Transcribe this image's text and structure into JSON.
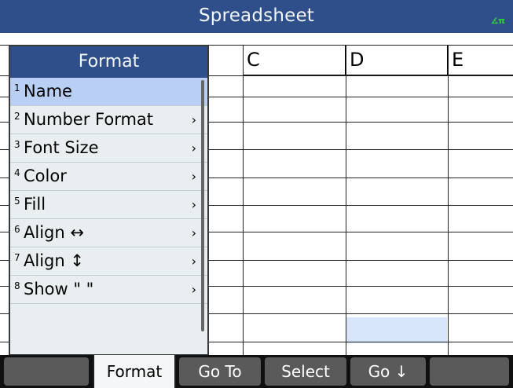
{
  "title_bar": {
    "title": "Spreadsheet",
    "angle_indicator": "∡π"
  },
  "spreadsheet": {
    "visible_columns": [
      "C",
      "D",
      "E"
    ],
    "selected_cell_column": "D"
  },
  "format_menu": {
    "header": "Format",
    "items": [
      {
        "num": "1",
        "label": "Name",
        "arrow": ""
      },
      {
        "num": "2",
        "label": "Number Format",
        "arrow": "›"
      },
      {
        "num": "3",
        "label": "Font Size",
        "arrow": "›"
      },
      {
        "num": "4",
        "label": "Color",
        "arrow": "›"
      },
      {
        "num": "5",
        "label": "Fill",
        "arrow": "›"
      },
      {
        "num": "6",
        "label": "Align ↔",
        "arrow": "›"
      },
      {
        "num": "7",
        "label": "Align ↕",
        "arrow": "›"
      },
      {
        "num": "8",
        "label": "Show \" \"",
        "arrow": "›"
      }
    ]
  },
  "softkeys": [
    "",
    "Format",
    "Go To",
    "Select",
    "Go ↓",
    ""
  ]
}
